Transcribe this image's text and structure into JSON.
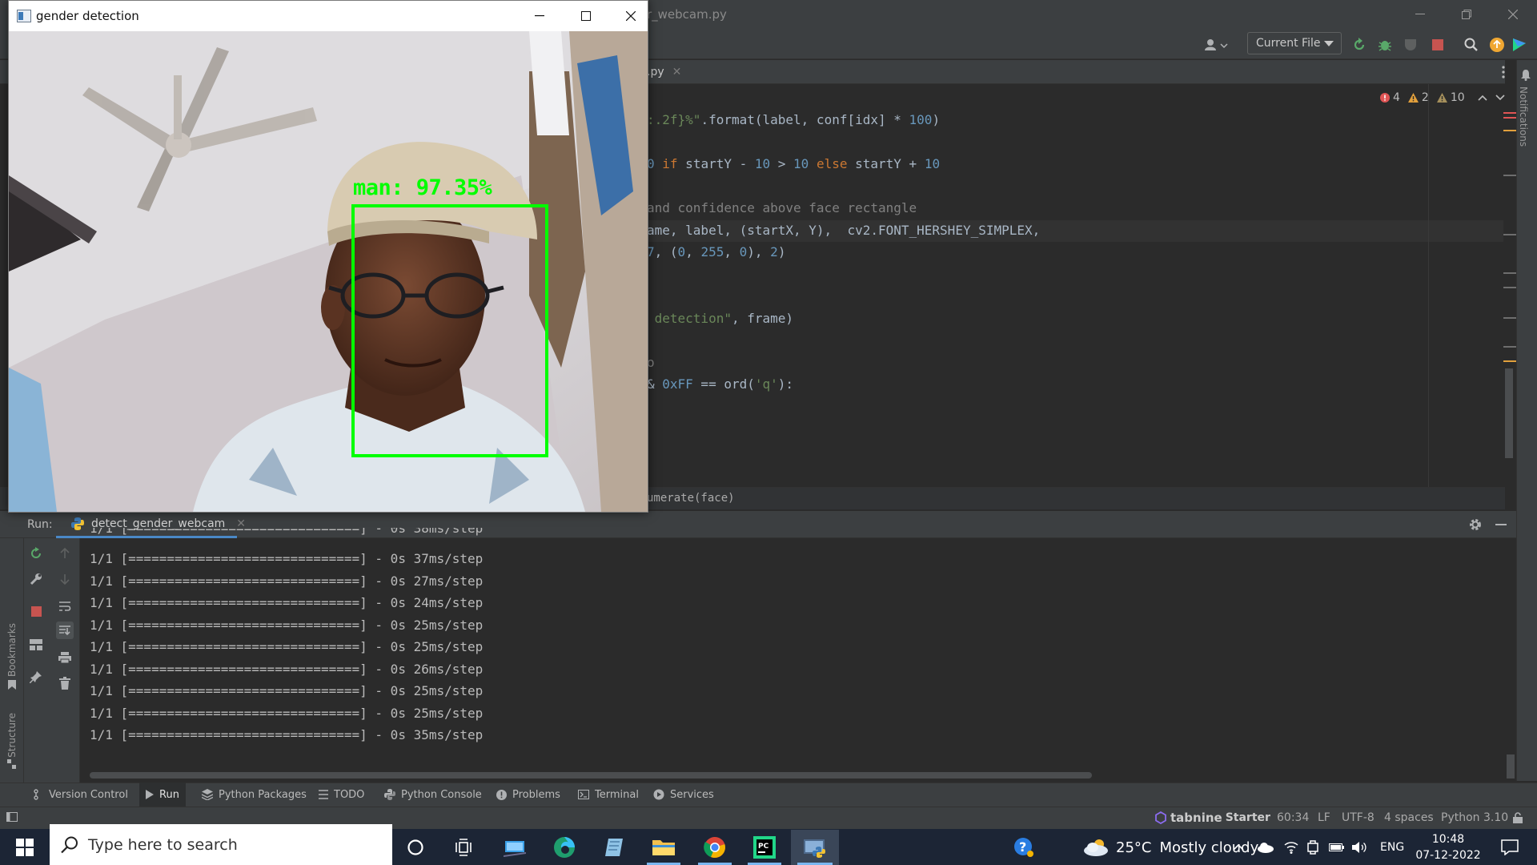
{
  "ide": {
    "window_title": "r_webcam.py",
    "run_config": "Current File",
    "editor_tab": ".py",
    "inspections": {
      "errors": "4",
      "warnings": "2",
      "weak_warnings": "10"
    },
    "code_lines": [
      {
        "parts": [
          {
            "t": "str",
            "v": ":.2f}%\""
          },
          {
            "t": "plain",
            "v": ".format(label, conf[idx] "
          },
          {
            "t": "plain",
            "v": "* "
          },
          {
            "t": "num",
            "v": "100"
          },
          {
            "t": "plain",
            "v": ")"
          }
        ]
      },
      {
        "parts": [
          {
            "t": "num",
            "v": "0"
          },
          {
            "t": "plain",
            "v": " "
          },
          {
            "t": "kw",
            "v": "if"
          },
          {
            "t": "plain",
            "v": " startY - "
          },
          {
            "t": "num",
            "v": "10"
          },
          {
            "t": "plain",
            "v": " > "
          },
          {
            "t": "num",
            "v": "10"
          },
          {
            "t": "plain",
            "v": " "
          },
          {
            "t": "kw",
            "v": "else"
          },
          {
            "t": "plain",
            "v": " startY + "
          },
          {
            "t": "num",
            "v": "10"
          }
        ]
      },
      {
        "parts": [
          {
            "t": "cm",
            "v": "and confidence above face rectangle"
          }
        ]
      },
      {
        "parts": [
          {
            "t": "plain",
            "v": "ame, label, (startX, Y),  cv2.FONT_HERSHEY_SIMPLEX,"
          }
        ]
      },
      {
        "parts": [
          {
            "t": "num",
            "v": "7"
          },
          {
            "t": "plain",
            "v": ", ("
          },
          {
            "t": "num",
            "v": "0"
          },
          {
            "t": "plain",
            "v": ", "
          },
          {
            "t": "num",
            "v": "255"
          },
          {
            "t": "plain",
            "v": ", "
          },
          {
            "t": "num",
            "v": "0"
          },
          {
            "t": "plain",
            "v": "), "
          },
          {
            "t": "num",
            "v": "2"
          },
          {
            "t": "plain",
            "v": ")"
          }
        ]
      },
      {
        "parts": [
          {
            "t": "str",
            "v": " detection\""
          },
          {
            "t": "plain",
            "v": ", frame)"
          }
        ]
      },
      {
        "parts": [
          {
            "t": "cm",
            "v": "o"
          }
        ]
      },
      {
        "parts": [
          {
            "t": "plain",
            "v": "& "
          },
          {
            "t": "num",
            "v": "0xFF"
          },
          {
            "t": "plain",
            "v": " == ord("
          },
          {
            "t": "str",
            "v": "'q'"
          },
          {
            "t": "plain",
            "v": "):"
          }
        ]
      }
    ],
    "breadcrumb": "umerate(face)",
    "notifications_label": "Notifications",
    "run": {
      "label": "Run:",
      "tab_label": "detect_gender_webcam",
      "partial_line": "1/1 [==============================] - 0s 38ms/step",
      "output_lines": [
        "1/1 [==============================] - 0s 37ms/step",
        "1/1 [==============================] - 0s 27ms/step",
        "1/1 [==============================] - 0s 24ms/step",
        "1/1 [==============================] - 0s 25ms/step",
        "1/1 [==============================] - 0s 25ms/step",
        "1/1 [==============================] - 0s 26ms/step",
        "1/1 [==============================] - 0s 25ms/step",
        "1/1 [==============================] - 0s 25ms/step",
        "1/1 [==============================] - 0s 35ms/step"
      ]
    },
    "side_labels": {
      "bookmarks": "Bookmarks",
      "structure": "Structure"
    },
    "tool_windows": [
      "Version Control",
      "Run",
      "Python Packages",
      "TODO",
      "Python Console",
      "Problems",
      "Terminal",
      "Services"
    ],
    "status": {
      "tabnine": "tabnine",
      "tabnine_plan": "Starter",
      "position": "60:34",
      "line_sep": "LF",
      "encoding": "UTF-8",
      "indent": "4 spaces",
      "interpreter": "Python 3.10"
    }
  },
  "cv_window": {
    "title": "gender detection",
    "box_label": "man: 97.35%"
  },
  "taskbar": {
    "search_placeholder": "Type here to search",
    "weather_temp": "25°C",
    "weather_text": "Mostly cloudy",
    "language": "ENG",
    "time": "10:48",
    "date": "07-12-2022"
  },
  "colors": {
    "ide_bg": "#2b2b2b",
    "ide_panel": "#3c3f41",
    "detection_green": "#00ff00",
    "taskbar_bg": "#1c2535",
    "error_red": "#e05555",
    "warning_yellow": "#e2a03c"
  }
}
